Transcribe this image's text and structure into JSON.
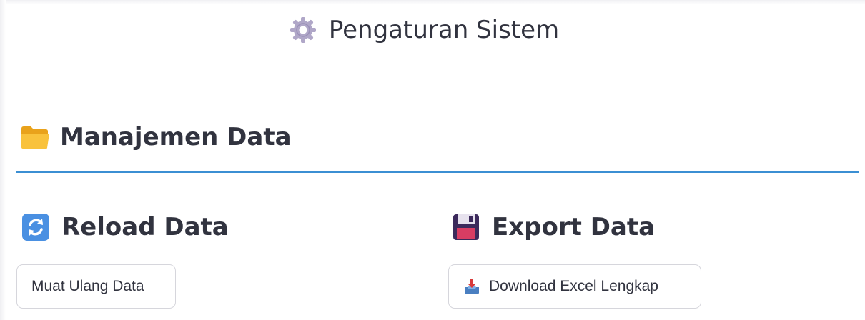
{
  "page": {
    "title": "Pengaturan Sistem",
    "title_icon": "gear-icon"
  },
  "section": {
    "title": "Manajemen Data",
    "icon": "folder-icon",
    "divider_color": "#3b8fd3"
  },
  "reload": {
    "title": "Reload Data",
    "icon": "reload-icon",
    "button_label": "Muat Ulang Data"
  },
  "export": {
    "title": "Export Data",
    "icon": "floppy-disk-icon",
    "button_icon": "download-tray-icon",
    "button_label": "Download Excel Lengkap"
  }
}
